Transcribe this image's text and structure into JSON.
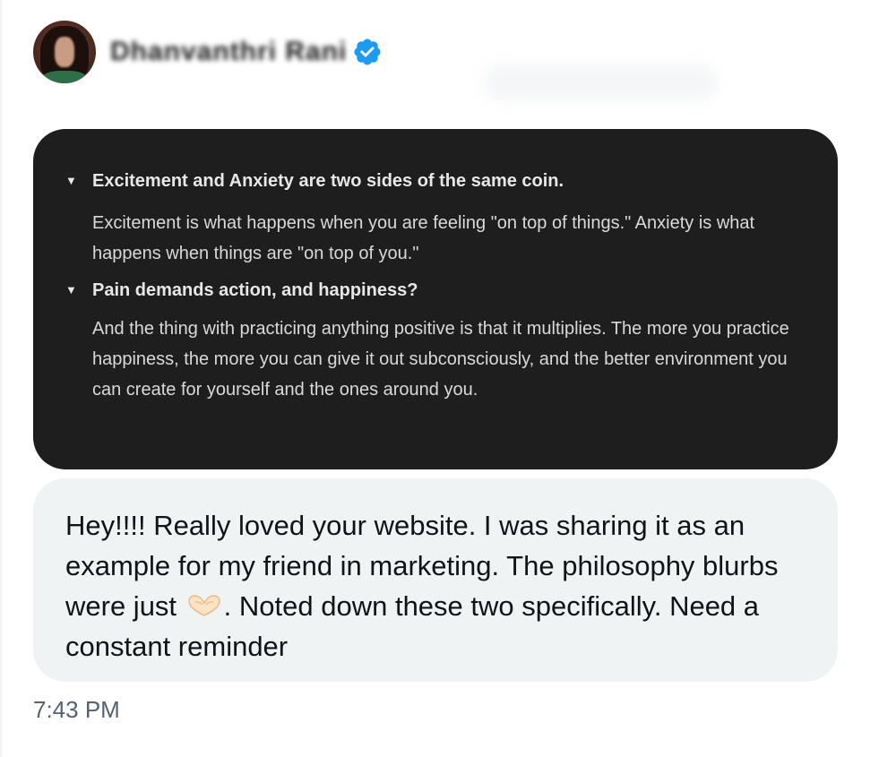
{
  "sender": {
    "name": "Dhanvanthri Rani",
    "verified": true,
    "verified_icon": "verified-badge-icon",
    "avatar_icon": "avatar"
  },
  "quote_card": {
    "items": [
      {
        "heading": "Excitement and Anxiety are two sides of the same coin.",
        "body": "Excitement is what happens when you are feeling \"on top of things.\" Anxiety is what happens when things are \"on top of you.\""
      },
      {
        "heading": "Pain demands action, and happiness?",
        "body": "And the thing with practicing anything positive is that it multiplies. The more you practice happiness, the more you can give it out subconsciously, and the better environment you can create for yourself and the ones around you."
      }
    ],
    "toggle_glyph": "▼"
  },
  "message": {
    "text_before_emoji": "Hey!!!! Really loved your website. I was sharing it as an example for my friend in marketing. The philosophy blurbs were just",
    "emoji_icon": "heart-hands-icon",
    "text_after_emoji": ". Noted down these two specifically. Need a constant reminder"
  },
  "timestamp": "7:43 PM",
  "colors": {
    "card_background": "#1e1e1e",
    "bubble_background": "#eff3f4",
    "verified_blue": "#1d9bf0",
    "timestamp_gray": "#536471"
  }
}
